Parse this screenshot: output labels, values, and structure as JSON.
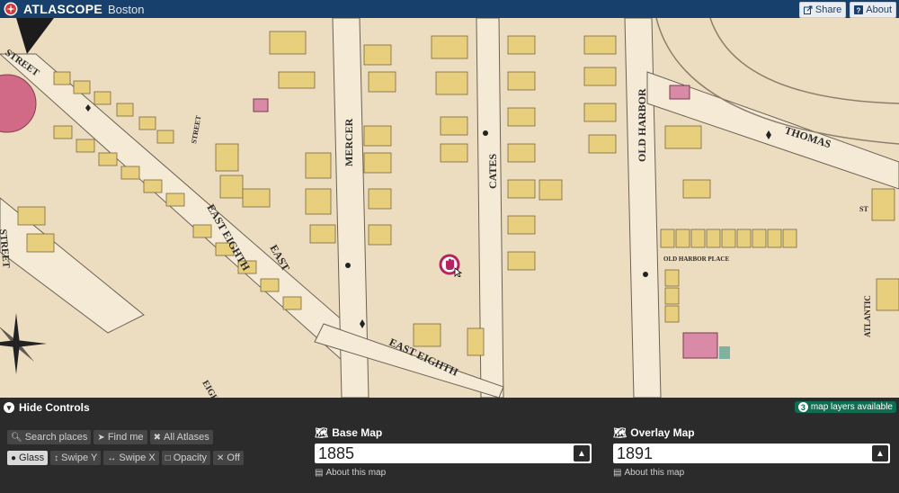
{
  "header": {
    "brand": "ATLASCOPE",
    "city": "Boston",
    "share_label": "Share",
    "about_label": "About",
    "bg_color": "#17406d"
  },
  "map": {
    "street_labels": [
      "STREET",
      "STREET",
      "STREET",
      "MERCER",
      "CATES",
      "OLD HARBOR",
      "THOMAS",
      "EAST EIGHTH",
      "EAST",
      "EIGHTH",
      "EAST EIGHTH",
      "OLD HARBOR PLACE",
      "ATLANTIC",
      "ST"
    ],
    "background_color": "#efe3cb"
  },
  "controls": {
    "hide_label": "Hide Controls",
    "layers_badge": {
      "count": "3",
      "text": "map layers available",
      "color": "#0f6d52"
    },
    "row1": [
      {
        "label": "Search places",
        "icon": "search-icon"
      },
      {
        "label": "Find me",
        "icon": "location-arrow-icon"
      },
      {
        "label": "All Atlases",
        "icon": "expand-icon"
      }
    ],
    "row2": [
      {
        "label": "Glass",
        "icon": "circle-icon",
        "active": true
      },
      {
        "label": "Swipe Y",
        "icon": "vertical-arrows-icon"
      },
      {
        "label": "Swipe X",
        "icon": "horizontal-arrows-icon"
      },
      {
        "label": "Opacity",
        "icon": "square-icon"
      },
      {
        "label": "Off",
        "icon": "x-icon"
      }
    ],
    "base_map": {
      "title": "Base Map",
      "value": "1885",
      "about": "About this map"
    },
    "overlay_map": {
      "title": "Overlay Map",
      "value": "1891",
      "about": "About this map"
    }
  }
}
